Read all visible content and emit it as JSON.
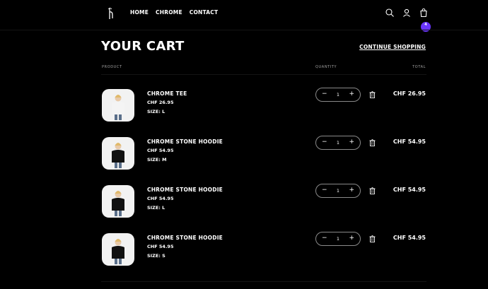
{
  "nav": {
    "links": [
      "HOME",
      "CHROME",
      "CONTACT"
    ],
    "cart_count": "4"
  },
  "cart": {
    "title": "YOUR CART",
    "continue_label": "CONTINUE SHOPPING",
    "col_product": "PRODUCT",
    "col_quantity": "QUANTITY",
    "col_total": "TOTAL",
    "items": [
      {
        "name": "CHROME TEE",
        "price": "CHF 26.95",
        "size": "SIZE: L",
        "qty": "1",
        "total": "CHF 26.95",
        "shirt": "#f4f4f4"
      },
      {
        "name": "CHROME STONE HOODIE",
        "price": "CHF 54.95",
        "size": "SIZE: M",
        "qty": "1",
        "total": "CHF 54.95",
        "shirt": "#111111"
      },
      {
        "name": "CHROME STONE HOODIE",
        "price": "CHF 54.95",
        "size": "SIZE: L",
        "qty": "1",
        "total": "CHF 54.95",
        "shirt": "#111111"
      },
      {
        "name": "CHROME STONE HOODIE",
        "price": "CHF 54.95",
        "size": "SIZE: S",
        "qty": "1",
        "total": "CHF 54.95",
        "shirt": "#111111"
      }
    ]
  },
  "colors": {
    "accent": "#6a35ff",
    "background": "#000000",
    "text": "#ffffff"
  }
}
